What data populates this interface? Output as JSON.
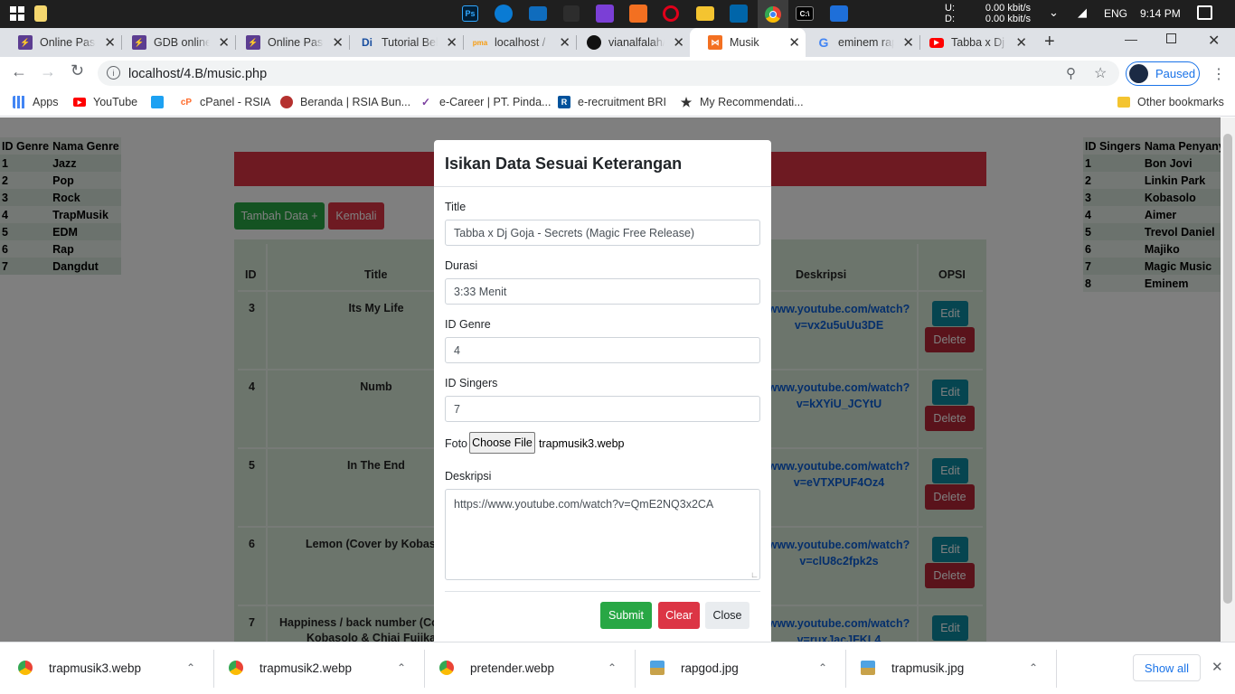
{
  "taskbar": {
    "net_upload_label": "U:",
    "net_download_label": "D:",
    "net_upload_value": "0.00 kbit/s",
    "net_download_value": "0.00 kbit/s",
    "language": "ENG",
    "time": "9:14 PM"
  },
  "tabs": [
    {
      "title": "Online Pasc",
      "icon": "bolt-icon",
      "color": "#5c3d91"
    },
    {
      "title": "GDB online",
      "icon": "bolt-icon",
      "color": "#5c3d91"
    },
    {
      "title": "Online Pasc",
      "icon": "bolt-icon",
      "color": "#5c3d91"
    },
    {
      "title": "Tutorial Bel",
      "icon": "di-icon",
      "color": "#ffffff"
    },
    {
      "title": "localhost /",
      "icon": "phpmyadmin-icon",
      "color": "#f89c0e"
    },
    {
      "title": "vianalfalah/",
      "icon": "github-icon",
      "color": "#111111"
    },
    {
      "title": "Musik",
      "icon": "xampp-icon",
      "color": "#f37021"
    },
    {
      "title": "eminem rap",
      "icon": "google-icon",
      "color": "#4285f4"
    },
    {
      "title": "Tabba x Dj",
      "icon": "youtube-icon",
      "color": "#ff0000"
    }
  ],
  "address": {
    "url": "localhost/4.B/music.php",
    "profile_status": "Paused"
  },
  "bookmarks": [
    {
      "label": "Apps",
      "icon": "apps-grid-icon",
      "color": "#4285f4"
    },
    {
      "label": "YouTube",
      "icon": "youtube-icon",
      "color": "#ff0000"
    },
    {
      "label": "",
      "icon": "twitter-icon",
      "color": "#1da1f2"
    },
    {
      "label": "cPanel - RSIA",
      "icon": "cpanel-icon",
      "color": "#ff6c2c"
    },
    {
      "label": "Beranda | RSIA Bun...",
      "icon": "rsia-icon",
      "color": "#b5312f"
    },
    {
      "label": "e-Career | PT. Pinda...",
      "icon": "career-icon",
      "color": "#7b3fa0"
    },
    {
      "label": "e-recruitment BRI",
      "icon": "bri-icon",
      "color": "#00529c"
    },
    {
      "label": "My Recommendati...",
      "icon": "star-icon",
      "color": "#333333"
    },
    {
      "label": "Other bookmarks",
      "icon": "folder-icon",
      "color": "#f4c430"
    }
  ],
  "genre_table": {
    "headers": [
      "ID Genre",
      "Nama Genre"
    ],
    "rows": [
      [
        "1",
        "Jazz"
      ],
      [
        "2",
        "Pop"
      ],
      [
        "3",
        "Rock"
      ],
      [
        "4",
        "TrapMusik"
      ],
      [
        "5",
        "EDM"
      ],
      [
        "6",
        "Rap"
      ],
      [
        "7",
        "Dangdut"
      ]
    ]
  },
  "singer_table": {
    "headers": [
      "ID Singers",
      "Nama Penyanyi"
    ],
    "rows": [
      [
        "1",
        "Bon Jovi"
      ],
      [
        "2",
        "Linkin Park"
      ],
      [
        "3",
        "Kobasolo"
      ],
      [
        "4",
        "Aimer"
      ],
      [
        "5",
        "Trevol Daniel"
      ],
      [
        "6",
        "Majiko"
      ],
      [
        "7",
        "Magic Music"
      ],
      [
        "8",
        "Eminem"
      ]
    ]
  },
  "actions": {
    "add_label": "Tambah Data +",
    "back_label": "Kembali"
  },
  "music_table": {
    "headers": {
      "id": "ID",
      "title": "Title",
      "desc": "Deskripsi",
      "opsi": "OPSI"
    },
    "edit_label": "Edit",
    "delete_label": "Delete",
    "rows": [
      {
        "id": "3",
        "title": "Its My Life",
        "desc1": "www.youtube.com/watch?",
        "desc2": "v=vx2u5uUu3DE"
      },
      {
        "id": "4",
        "title": "Numb",
        "desc1": "www.youtube.com/watch?",
        "desc2": "v=kXYiU_JCYtU"
      },
      {
        "id": "5",
        "title": "In The End",
        "desc1": "www.youtube.com/watch?",
        "desc2": "v=eVTXPUF4Oz4"
      },
      {
        "id": "6",
        "title": "Lemon (Cover by Kobasol",
        "desc1": "www.youtube.com/watch?",
        "desc2": "v=clU8c2fpk2s"
      },
      {
        "id": "7",
        "title": "Happiness / back number (Cov",
        "title2": "Kobasolo & Chiai Fujikaw",
        "desc1": "www.youtube.com/watch?",
        "desc2": "v=ruxJacJFKL4"
      }
    ]
  },
  "modal": {
    "title": "Isikan Data Sesuai Keterangan",
    "title_label": "Title",
    "title_value": "Tabba x Dj Goja - Secrets (Magic Free Release)",
    "durasi_label": "Durasi",
    "durasi_value": "3:33 Menit",
    "genre_label": "ID Genre",
    "genre_value": "4",
    "singers_label": "ID Singers",
    "singers_value": "7",
    "foto_label": "Foto",
    "choose_file_label": "Choose File",
    "file_name": "trapmusik3.webp",
    "desc_label": "Deskripsi",
    "desc_value": "https://www.youtube.com/watch?v=QmE2NQ3x2CA",
    "submit_label": "Submit",
    "clear_label": "Clear",
    "close_label": "Close"
  },
  "downloads": {
    "items": [
      {
        "name": "trapmusik3.webp",
        "icon": "chrome-icon"
      },
      {
        "name": "trapmusik2.webp",
        "icon": "chrome-icon"
      },
      {
        "name": "pretender.webp",
        "icon": "chrome-icon"
      },
      {
        "name": "rapgod.jpg",
        "icon": "image-icon"
      },
      {
        "name": "trapmusik.jpg",
        "icon": "image-icon"
      }
    ],
    "show_all_label": "Show all"
  },
  "colors": {
    "danger": "#dc3545",
    "success": "#28a745",
    "info": "#17a2b8",
    "table_bg": "#d9ead9",
    "link": "#0b5ed7"
  }
}
